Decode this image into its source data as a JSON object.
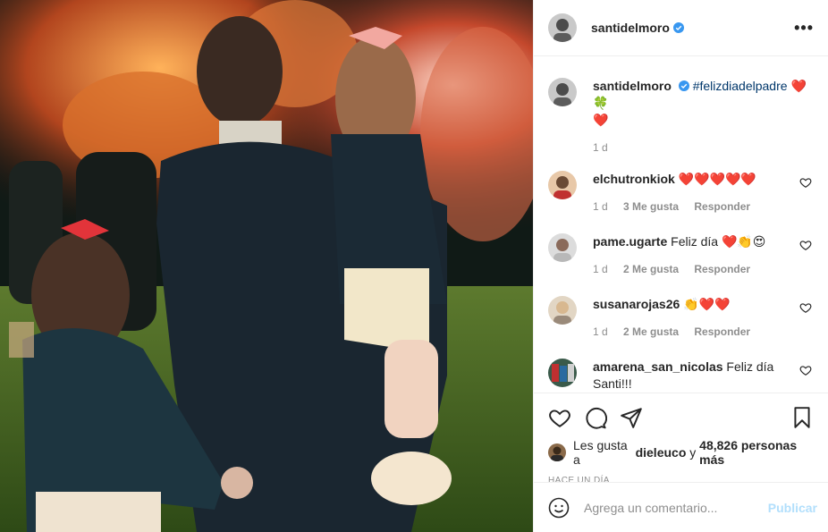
{
  "post": {
    "username": "santidelmoro",
    "verified": true,
    "more_label": "•••",
    "caption": {
      "username": "santidelmoro",
      "hashtag": "#felizdiadelpadre",
      "emojis": "❤️🍀",
      "line2": "❤️",
      "time": "1 d"
    }
  },
  "comments": [
    {
      "username": "elchutronkiok",
      "text": "❤️❤️❤️❤️❤️",
      "time": "1 d",
      "likes": "3 Me gusta",
      "reply": "Responder"
    },
    {
      "username": "pame.ugarte",
      "text": "Feliz día ❤️👏😍",
      "time": "1 d",
      "likes": "2 Me gusta",
      "reply": "Responder"
    },
    {
      "username": "susanarojas26",
      "text": "👏❤️❤️",
      "time": "1 d",
      "likes": "2 Me gusta",
      "reply": "Responder"
    },
    {
      "username": "amarena_san_nicolas",
      "text": "Feliz día Santi!!!",
      "time": "",
      "likes": "",
      "reply": ""
    }
  ],
  "likes": {
    "prefix": "Les gusta a",
    "first_user": "dieleuco",
    "joiner": "y",
    "others": "48,826 personas más"
  },
  "posted_ago": "HACE UN DÍA",
  "comment_box": {
    "placeholder": "Agrega un comentario...",
    "post_label": "Publicar"
  },
  "colors": {
    "verified": "#3897f0",
    "heart": "#e0245e",
    "link": "#00376b",
    "post_disabled": "#b2dffc"
  },
  "icons": [
    "more-icon",
    "verified-icon",
    "heart-icon",
    "comment-icon",
    "share-icon",
    "bookmark-icon",
    "emoji-icon",
    "comment-like-icon"
  ]
}
